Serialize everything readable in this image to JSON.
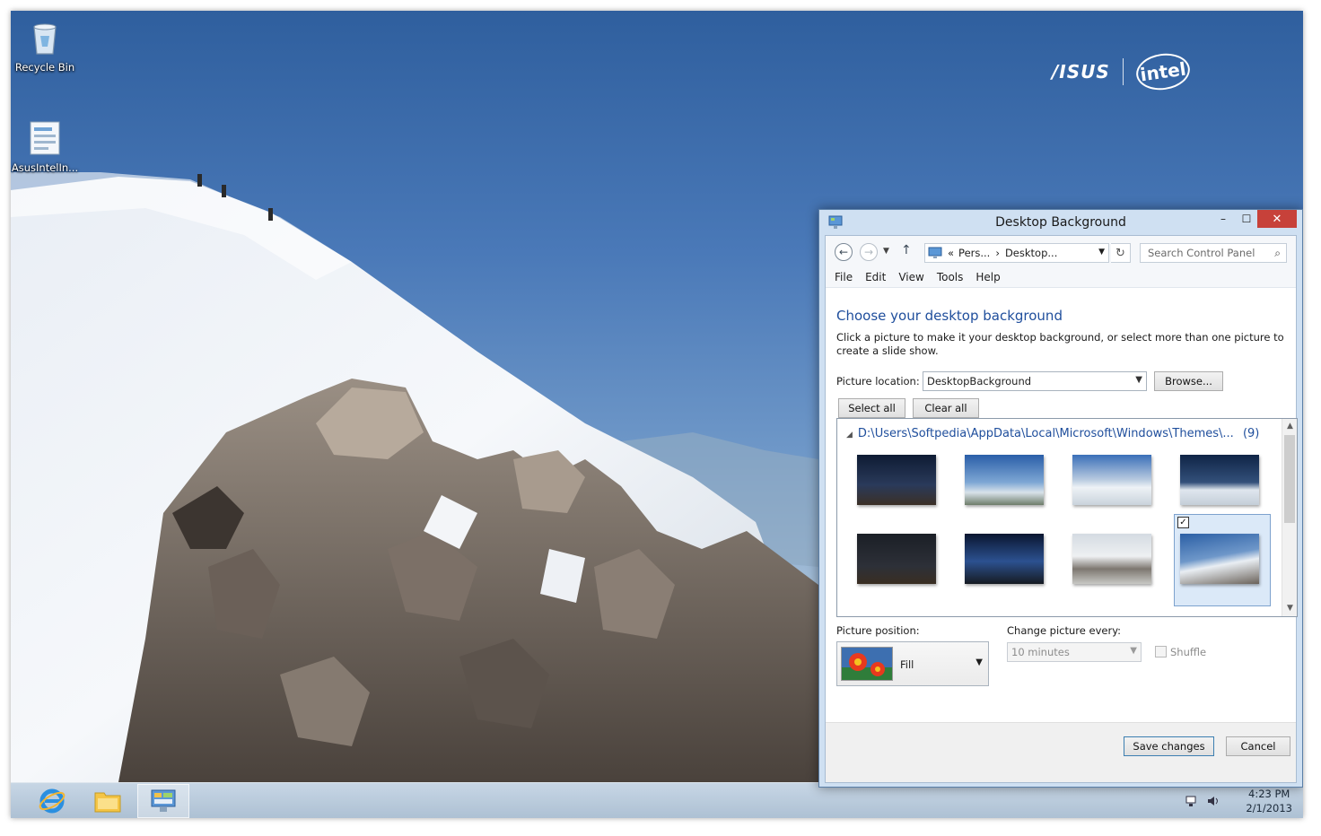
{
  "desktop": {
    "icons": [
      {
        "label": "Recycle Bin",
        "icon": "recycle-bin-icon"
      },
      {
        "label": "AsusIntelIn...",
        "icon": "document-shortcut-icon"
      }
    ],
    "brand": {
      "asus": "/ISUS",
      "intel": "intel"
    }
  },
  "taskbar": {
    "apps": [
      {
        "name": "Internet Explorer",
        "icon": "internet-explorer-icon"
      },
      {
        "name": "File Explorer",
        "icon": "folder-icon"
      },
      {
        "name": "Control Panel",
        "icon": "control-panel-icon"
      }
    ],
    "time": "4:23 PM",
    "date": "2/1/2013"
  },
  "window": {
    "title": "Desktop Background",
    "close_glyph": "✕",
    "minimize_glyph": "–",
    "maximize_glyph": "☐",
    "breadcrumb": {
      "lead": "«",
      "items": [
        "Pers...",
        "Desktop..."
      ],
      "sep": "›"
    },
    "search_placeholder": "Search Control Panel",
    "menu": [
      "File",
      "Edit",
      "View",
      "Tools",
      "Help"
    ],
    "heading": "Choose your desktop background",
    "description": "Click a picture to make it your desktop background, or select more than one picture to create a slide show.",
    "picture_location_label": "Picture location:",
    "picture_location_value": "DesktopBackground",
    "browse_label": "Browse...",
    "select_all_label": "Select all",
    "clear_all_label": "Clear all",
    "gallery": {
      "path": "D:\\Users\\Softpedia\\AppData\\Local\\Microsoft\\Windows\\Themes\\...",
      "count": "(9)",
      "selected_index": 7,
      "checkmark": "✓"
    },
    "picture_position_label": "Picture position:",
    "picture_position_value": "Fill",
    "change_every_label": "Change picture every:",
    "change_every_value": "10 minutes",
    "shuffle_label": "Shuffle",
    "save_label": "Save changes",
    "cancel_label": "Cancel"
  },
  "colors": {
    "accent": "#1f4e9c",
    "close": "#c7413a",
    "selection": "#dbe9f8"
  }
}
